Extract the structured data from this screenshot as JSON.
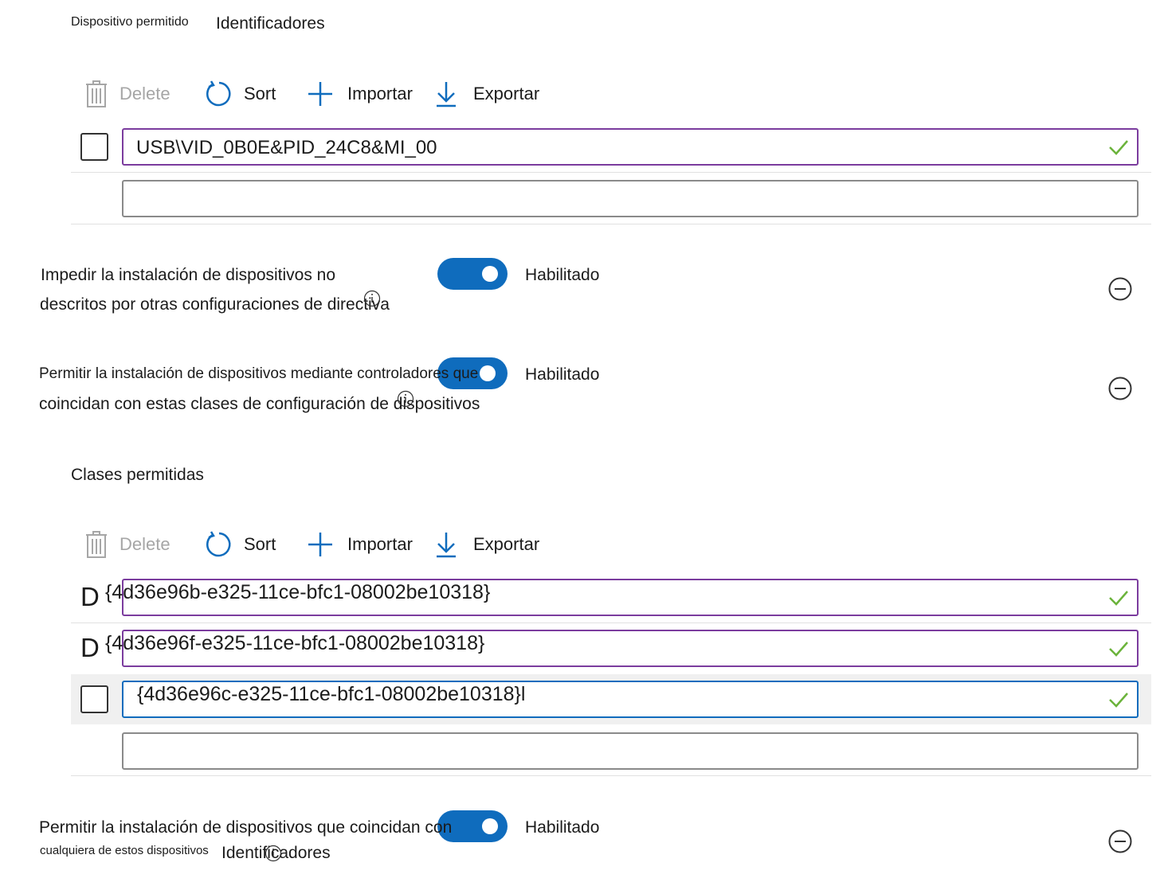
{
  "section1": {
    "title_small": "Dispositivo permitido",
    "title_large": "Identificadores",
    "toolbar": {
      "delete": "Delete",
      "sort": "Sort",
      "import": "Importar",
      "export": "Exportar"
    },
    "rows": [
      {
        "value": "USB\\VID_0B0E&PID_24C8&MI_00"
      },
      {
        "value": ""
      }
    ]
  },
  "setting1": {
    "label_line1": "Impedir la instalación de dispositivos no",
    "label_line2": "descritos por otras configuraciones de directiva",
    "state": "Habilitado"
  },
  "setting2": {
    "label_line1": "Permitir la instalación de dispositivos mediante controladores que",
    "label_line2": "coincidan con estas clases de configuración de dispositivos",
    "state": "Habilitado"
  },
  "section2": {
    "title": "Clases permitidas",
    "toolbar": {
      "delete": "Delete",
      "sort": "Sort",
      "import": "Importar",
      "export": "Exportar"
    },
    "rows": [
      {
        "prefix": "D",
        "value": "{4d36e96b-e325-11ce-bfc1-08002be10318}"
      },
      {
        "prefix": "D",
        "value": "{4d36e96f-e325-11ce-bfc1-08002be10318}"
      },
      {
        "value": "{4d36e96c-e325-11ce-bfc1-08002be10318}l"
      },
      {
        "value": ""
      }
    ]
  },
  "setting3": {
    "label_line1": "Permitir la instalación de dispositivos que coincidan con",
    "label_line2_small": "cualquiera de estos dispositivos",
    "label_line2_large": "Identificadores",
    "state": "Habilitado"
  },
  "colors": {
    "accent": "#0f6cbd",
    "valid_border": "#7b3c9e",
    "check": "#6bb33b",
    "disabled": "#a6a6a6"
  }
}
